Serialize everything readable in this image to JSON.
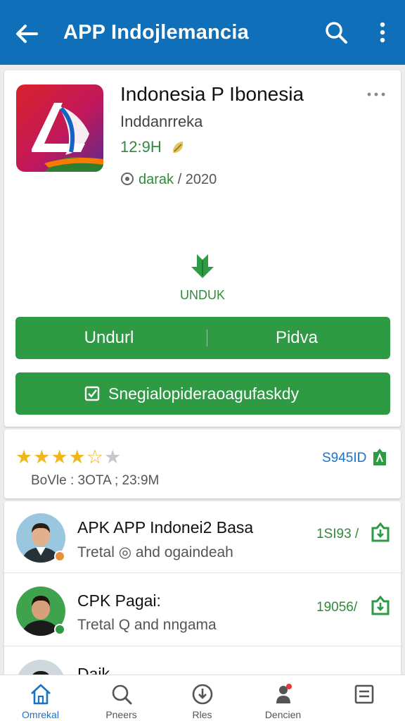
{
  "appbar": {
    "title": "APP Indojlemancia",
    "bg": "#0f6fb8"
  },
  "app": {
    "name": "Indonesia P Ibonesia",
    "developer": "Inddanrreka",
    "version": "12:9H",
    "meta_highlight": "darak",
    "meta_rest": " / 2020"
  },
  "download": {
    "icon_label": "UNDUK",
    "left_button": "Undurl",
    "right_button": "Pidva",
    "wide_button": "Snegialopideraoagufaskdy"
  },
  "rating": {
    "stars_filled": 4,
    "stars_outline": 1,
    "stars_empty": 1,
    "count": "S945ID",
    "subtitle": "BoVle : 3OTA ; 23:9M"
  },
  "list": [
    {
      "title": "APK APP Indonei2 Basa",
      "subtitle": "Tretal  ◎ ahd ogaindeah",
      "count": "1SI93 /",
      "badge_color": "#e8903a"
    },
    {
      "title": "CPK Pagai:",
      "subtitle": "Tretal  Q and nngama",
      "count": "19056/",
      "badge_color": "#2e9a44"
    },
    {
      "title": "Daik",
      "subtitle": "",
      "count": "",
      "badge_color": "#2e9a44"
    }
  ],
  "nav": [
    {
      "label": "Omrekal",
      "icon": "home-icon",
      "active": true
    },
    {
      "label": "Pneers",
      "icon": "search-icon",
      "active": false
    },
    {
      "label": "Rles",
      "icon": "download-icon",
      "active": false
    },
    {
      "label": "Dencien",
      "icon": "user-icon",
      "active": false
    },
    {
      "label": "",
      "icon": "list-icon",
      "active": false
    }
  ],
  "colors": {
    "accent_green": "#2e9a44",
    "primary_blue": "#0f6fb8",
    "star": "#f2b51c"
  }
}
